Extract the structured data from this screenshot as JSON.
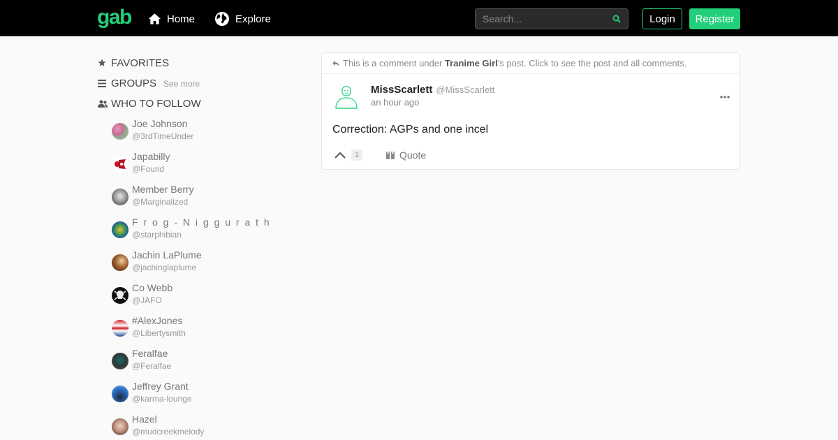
{
  "header": {
    "logo": "gab",
    "nav": [
      {
        "label": "Home",
        "icon": "home-icon"
      },
      {
        "label": "Explore",
        "icon": "globe-icon"
      }
    ],
    "search_placeholder": "Search...",
    "login_label": "Login",
    "register_label": "Register"
  },
  "sidebar": {
    "favorites": "FAVORITES",
    "groups": "GROUPS",
    "see_more": "See more",
    "who_to_follow": "WHO TO FOLLOW",
    "follow": [
      {
        "name": "Joe Johnson",
        "handle": "@3rdTimeUnder"
      },
      {
        "name": "Japabilly",
        "handle": "@Found"
      },
      {
        "name": "Member Berry",
        "handle": "@Marginalized"
      },
      {
        "name": "F r o g - N i g g u r a t h",
        "handle": "@starphibian"
      },
      {
        "name": "Jachin LaPlume",
        "handle": "@jachinglaplume"
      },
      {
        "name": "Co Webb",
        "handle": "@JAFO"
      },
      {
        "name": "#AlexJones",
        "handle": "@Libertysmith"
      },
      {
        "name": "Feralfae",
        "handle": "@Feralfae"
      },
      {
        "name": "Jeffrey Grant",
        "handle": "@karma-lounge"
      },
      {
        "name": "Hazel",
        "handle": "@mudcreekmelody"
      }
    ]
  },
  "post": {
    "note_prefix": "This is a comment under ",
    "note_author": "Tranime Girl",
    "note_suffix": "'s post. Click to see the post and all comments.",
    "author_name": "MissScarlett",
    "author_handle": "@MissScarlett",
    "time": "an hour ago",
    "body": "Correction: AGPs and one incel",
    "votes": "1",
    "quote_label": "Quote"
  },
  "colors": {
    "brand_green": "#21cf7a",
    "topbar": "#000000",
    "background": "#fafafa"
  }
}
